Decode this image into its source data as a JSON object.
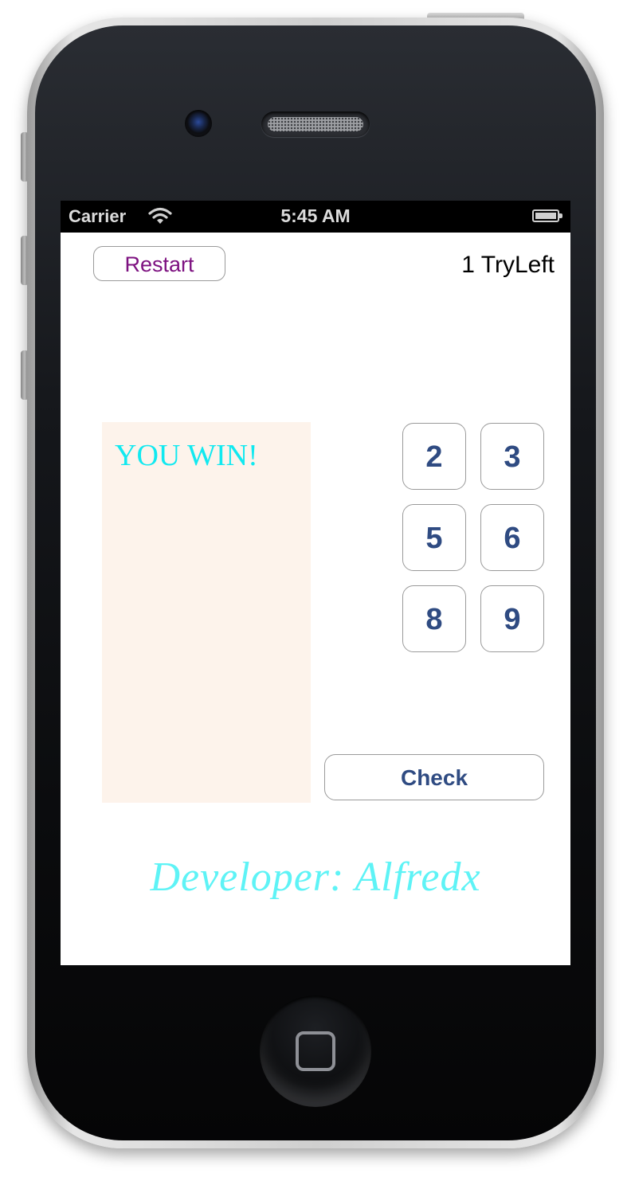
{
  "status_bar": {
    "carrier": "Carrier",
    "time": "5:45 AM",
    "wifi_icon": "wifi-icon",
    "battery_icon": "battery-icon"
  },
  "header": {
    "restart_label": "Restart",
    "tries_label": "1 TryLeft"
  },
  "result": {
    "message": "YOU WIN!"
  },
  "keypad": {
    "buttons": [
      "2",
      "3",
      "5",
      "6",
      "8",
      "9"
    ]
  },
  "check_label": "Check",
  "footer": {
    "developer": "Developer: Alfredx"
  },
  "colors": {
    "restart_text": "#7d1180",
    "result_text": "#11e9f0",
    "button_text": "#2f4b82",
    "result_panel_bg": "#fdf3eb",
    "developer_text": "#5ef3f6"
  }
}
